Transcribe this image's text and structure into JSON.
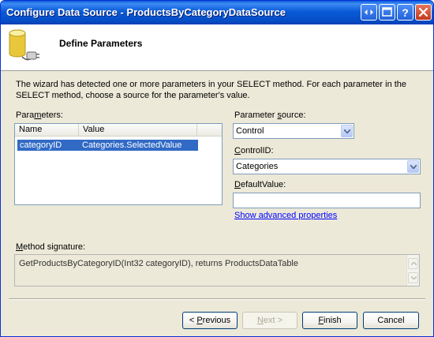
{
  "window": {
    "title": "Configure Data Source - ProductsByCategoryDataSource",
    "title_colors": {
      "start": "#0a5bd8",
      "end": "#0a3fb5"
    }
  },
  "header": {
    "title": "Define Parameters"
  },
  "description": "The wizard has detected one or more parameters in your SELECT method. For each parameter in the SELECT method, choose a source for the parameter's value.",
  "parameters": {
    "label_pre": "Para",
    "label_mn": "m",
    "label_post": "eters:",
    "columns": [
      "Name",
      "Value"
    ],
    "rows": [
      {
        "name": "categoryID",
        "value": "Categories.SelectedValue",
        "selected": true
      }
    ]
  },
  "parameter_source": {
    "label_pre": "Parameter ",
    "label_mn": "s",
    "label_post": "ource:",
    "value": "Control"
  },
  "control_id": {
    "label_pre": "",
    "label_mn": "C",
    "label_post": "ontrolID:",
    "value": "Categories"
  },
  "default_value": {
    "label_pre": "",
    "label_mn": "D",
    "label_post": "efaultValue:",
    "value": ""
  },
  "advanced_link": "Show advanced properties",
  "method_signature": {
    "label_pre": "",
    "label_mn": "M",
    "label_post": "ethod signature:",
    "value": "GetProductsByCategoryID(Int32 categoryID), returns ProductsDataTable"
  },
  "buttons": {
    "previous": {
      "pre": "< ",
      "mn": "P",
      "post": "revious",
      "enabled": true
    },
    "next": {
      "pre": "",
      "mn": "N",
      "post": "ext >",
      "enabled": false
    },
    "finish": {
      "pre": "",
      "mn": "F",
      "post": "inish",
      "enabled": true
    },
    "cancel": {
      "pre": "",
      "mn": "",
      "post": "Cancel",
      "enabled": true
    }
  },
  "icons": {
    "header": "database-plug-icon",
    "title_buttons": [
      "restore-arrows-icon",
      "maximize-icon",
      "help-icon",
      "close-icon"
    ]
  },
  "colors": {
    "selection": "#316ac5",
    "link": "#0000ff",
    "dialog_bg": "#ece9d8"
  }
}
